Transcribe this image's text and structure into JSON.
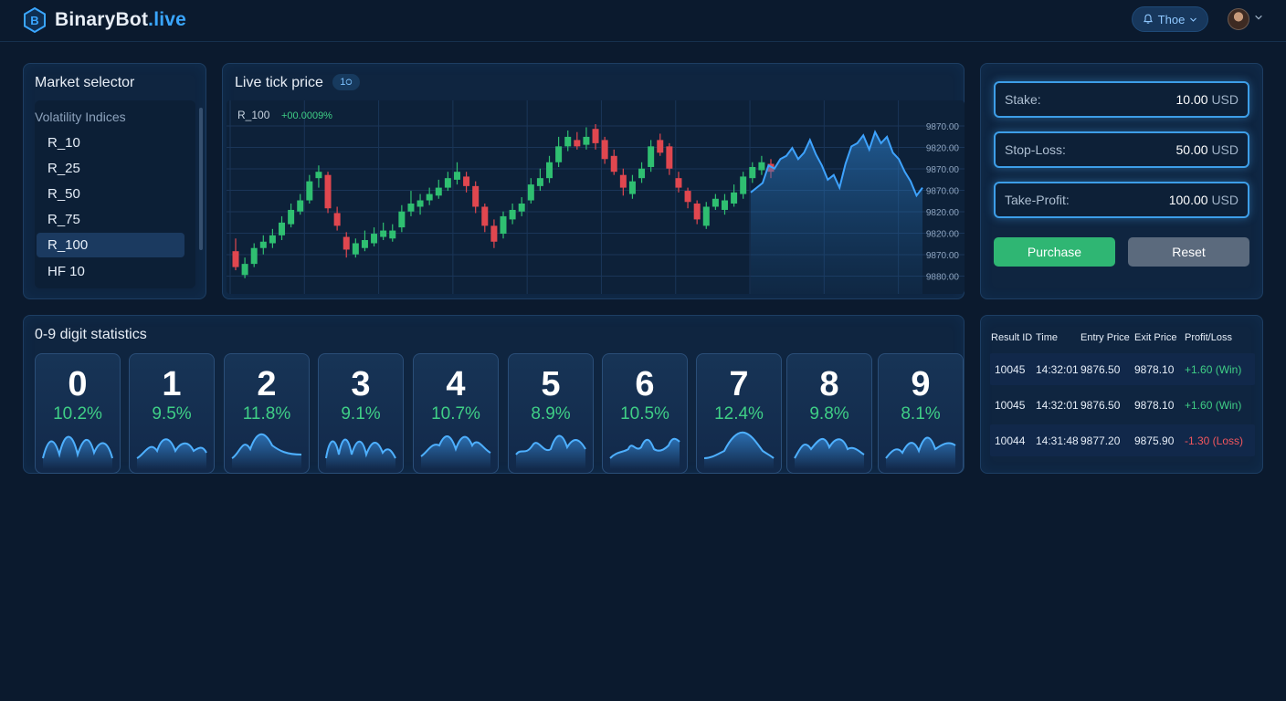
{
  "brand": {
    "name": "BinaryBot",
    "tld": ".live",
    "logo_letter": "B"
  },
  "header": {
    "user_name": "Thoe",
    "bell_icon": "bell-icon",
    "caret_icon": "chevron-down-icon"
  },
  "market_selector": {
    "title": "Market selector",
    "group_label": "Volatility Indices",
    "items": [
      "R_10",
      "R_25",
      "R_50",
      "R_75",
      "R_100",
      "HF 10"
    ],
    "selected": "R_100"
  },
  "chart": {
    "title": "Live tick price",
    "badge": "1੦",
    "symbol": "R_100",
    "change": "+00.0009%",
    "colors": {
      "up": "#2fbf71",
      "down": "#e0474f",
      "line": "#3ea3ff"
    },
    "chart_data": {
      "type": "line",
      "y_tick_labels": [
        "9870.00",
        "9820.00",
        "9870.00",
        "9870.00",
        "9820.00",
        "9820.00",
        "9870.00",
        "9880.00"
      ],
      "candles_relative": [
        {
          "o": 0.2,
          "c": 0.1,
          "h": 0.28,
          "l": 0.08
        },
        {
          "o": 0.05,
          "c": 0.12,
          "h": 0.16,
          "l": 0.03
        },
        {
          "o": 0.12,
          "c": 0.22,
          "h": 0.25,
          "l": 0.1
        },
        {
          "o": 0.22,
          "c": 0.26,
          "h": 0.3,
          "l": 0.18
        },
        {
          "o": 0.25,
          "c": 0.3,
          "h": 0.34,
          "l": 0.22
        },
        {
          "o": 0.3,
          "c": 0.38,
          "h": 0.42,
          "l": 0.27
        },
        {
          "o": 0.37,
          "c": 0.46,
          "h": 0.5,
          "l": 0.35
        },
        {
          "o": 0.45,
          "c": 0.52,
          "h": 0.56,
          "l": 0.43
        },
        {
          "o": 0.52,
          "c": 0.64,
          "h": 0.68,
          "l": 0.5
        },
        {
          "o": 0.66,
          "c": 0.7,
          "h": 0.74,
          "l": 0.6
        },
        {
          "o": 0.68,
          "c": 0.47,
          "h": 0.7,
          "l": 0.44
        },
        {
          "o": 0.44,
          "c": 0.36,
          "h": 0.48,
          "l": 0.33
        },
        {
          "o": 0.29,
          "c": 0.21,
          "h": 0.32,
          "l": 0.16
        },
        {
          "o": 0.18,
          "c": 0.25,
          "h": 0.28,
          "l": 0.16
        },
        {
          "o": 0.22,
          "c": 0.27,
          "h": 0.33,
          "l": 0.2
        },
        {
          "o": 0.25,
          "c": 0.31,
          "h": 0.35,
          "l": 0.23
        },
        {
          "o": 0.29,
          "c": 0.33,
          "h": 0.38,
          "l": 0.27
        },
        {
          "o": 0.28,
          "c": 0.33,
          "h": 0.37,
          "l": 0.26
        },
        {
          "o": 0.35,
          "c": 0.45,
          "h": 0.49,
          "l": 0.32
        },
        {
          "o": 0.45,
          "c": 0.5,
          "h": 0.58,
          "l": 0.42
        },
        {
          "o": 0.48,
          "c": 0.52,
          "h": 0.56,
          "l": 0.43
        },
        {
          "o": 0.52,
          "c": 0.56,
          "h": 0.6,
          "l": 0.49
        },
        {
          "o": 0.55,
          "c": 0.6,
          "h": 0.65,
          "l": 0.53
        },
        {
          "o": 0.6,
          "c": 0.66,
          "h": 0.7,
          "l": 0.58
        },
        {
          "o": 0.65,
          "c": 0.7,
          "h": 0.76,
          "l": 0.62
        },
        {
          "o": 0.67,
          "c": 0.61,
          "h": 0.7,
          "l": 0.57
        },
        {
          "o": 0.61,
          "c": 0.48,
          "h": 0.64,
          "l": 0.44
        },
        {
          "o": 0.48,
          "c": 0.36,
          "h": 0.5,
          "l": 0.32
        },
        {
          "o": 0.36,
          "c": 0.26,
          "h": 0.4,
          "l": 0.22
        },
        {
          "o": 0.31,
          "c": 0.42,
          "h": 0.45,
          "l": 0.28
        },
        {
          "o": 0.4,
          "c": 0.46,
          "h": 0.5,
          "l": 0.37
        },
        {
          "o": 0.45,
          "c": 0.5,
          "h": 0.54,
          "l": 0.42
        },
        {
          "o": 0.52,
          "c": 0.62,
          "h": 0.66,
          "l": 0.5
        },
        {
          "o": 0.61,
          "c": 0.66,
          "h": 0.72,
          "l": 0.58
        },
        {
          "o": 0.66,
          "c": 0.76,
          "h": 0.8,
          "l": 0.63
        },
        {
          "o": 0.76,
          "c": 0.86,
          "h": 0.92,
          "l": 0.73
        },
        {
          "o": 0.86,
          "c": 0.92,
          "h": 0.96,
          "l": 0.83
        },
        {
          "o": 0.9,
          "c": 0.86,
          "h": 0.95,
          "l": 0.84
        },
        {
          "o": 0.87,
          "c": 0.92,
          "h": 0.98,
          "l": 0.84
        },
        {
          "o": 0.97,
          "c": 0.88,
          "h": 1.0,
          "l": 0.84
        },
        {
          "o": 0.9,
          "c": 0.78,
          "h": 0.92,
          "l": 0.75
        },
        {
          "o": 0.8,
          "c": 0.7,
          "h": 0.84,
          "l": 0.68
        },
        {
          "o": 0.68,
          "c": 0.6,
          "h": 0.72,
          "l": 0.55
        },
        {
          "o": 0.56,
          "c": 0.64,
          "h": 0.68,
          "l": 0.53
        },
        {
          "o": 0.66,
          "c": 0.72,
          "h": 0.76,
          "l": 0.63
        },
        {
          "o": 0.73,
          "c": 0.86,
          "h": 0.9,
          "l": 0.7
        },
        {
          "o": 0.9,
          "c": 0.82,
          "h": 0.94,
          "l": 0.8
        },
        {
          "o": 0.86,
          "c": 0.72,
          "h": 0.88,
          "l": 0.68
        },
        {
          "o": 0.66,
          "c": 0.6,
          "h": 0.7,
          "l": 0.57
        },
        {
          "o": 0.58,
          "c": 0.51,
          "h": 0.6,
          "l": 0.47
        },
        {
          "o": 0.5,
          "c": 0.4,
          "h": 0.52,
          "l": 0.37
        },
        {
          "o": 0.36,
          "c": 0.48,
          "h": 0.51,
          "l": 0.34
        },
        {
          "o": 0.48,
          "c": 0.53,
          "h": 0.56,
          "l": 0.46
        },
        {
          "o": 0.46,
          "c": 0.52,
          "h": 0.56,
          "l": 0.43
        },
        {
          "o": 0.5,
          "c": 0.57,
          "h": 0.62,
          "l": 0.48
        },
        {
          "o": 0.56,
          "c": 0.67,
          "h": 0.7,
          "l": 0.53
        },
        {
          "o": 0.66,
          "c": 0.73,
          "h": 0.76,
          "l": 0.63
        },
        {
          "o": 0.71,
          "c": 0.76,
          "h": 0.8,
          "l": 0.68
        },
        {
          "o": 0.75,
          "c": 0.7,
          "h": 0.78,
          "l": 0.66
        }
      ],
      "line_relative": [
        0.57,
        0.6,
        0.63,
        0.74,
        0.72,
        0.78,
        0.8,
        0.85,
        0.78,
        0.82,
        0.9,
        0.81,
        0.74,
        0.65,
        0.68,
        0.6,
        0.75,
        0.86,
        0.88,
        0.93,
        0.84,
        0.95,
        0.88,
        0.92,
        0.82,
        0.78,
        0.7,
        0.64,
        0.55,
        0.6
      ]
    }
  },
  "trade_form": {
    "stake": {
      "label": "Stake:",
      "value": "10.00",
      "unit": "USD"
    },
    "stop_loss": {
      "label": "Stop-Loss:",
      "value": "50.00",
      "unit": "USD"
    },
    "take_profit": {
      "label": "Take-Profit:",
      "value": "100.00",
      "unit": "USD"
    },
    "purchase_label": "Purchase",
    "reset_label": "Reset",
    "colors": {
      "purchase": "#2fb673",
      "reset": "#5b6a7d",
      "accent": "#3d9ee8"
    }
  },
  "digit_stats": {
    "title": "0-9 digit statistics",
    "digits": [
      {
        "digit": "0",
        "pct": "10.2%"
      },
      {
        "digit": "1",
        "pct": "9.5%"
      },
      {
        "digit": "2",
        "pct": "11.8%"
      },
      {
        "digit": "3",
        "pct": "9.1%"
      },
      {
        "digit": "4",
        "pct": "10.7%"
      },
      {
        "digit": "5",
        "pct": "8.9%"
      },
      {
        "digit": "6",
        "pct": "10.5%"
      },
      {
        "digit": "7",
        "pct": "12.4%"
      },
      {
        "digit": "8",
        "pct": "9.8%"
      },
      {
        "digit": "9",
        "pct": "8.1%"
      }
    ]
  },
  "results": {
    "headers": [
      "Result ID",
      "Time",
      "Entry Price",
      "Exit Price",
      "Profit/Loss"
    ],
    "rows": [
      {
        "id": "10045",
        "time": "14:32:01",
        "entry": "9876.50",
        "exit": "9878.10",
        "pl": "+1.60 (Win)",
        "status": "win"
      },
      {
        "id": "10045",
        "time": "14:32:01",
        "entry": "9876.50",
        "exit": "9878.10",
        "pl": "+1.60 (Win)",
        "status": "win"
      },
      {
        "id": "10044",
        "time": "14:31:48",
        "entry": "9877.20",
        "exit": "9875.90",
        "pl": "-1.30 (Loss)",
        "status": "loss"
      }
    ],
    "colors": {
      "win": "#3fcf86",
      "loss": "#f2565d"
    }
  }
}
